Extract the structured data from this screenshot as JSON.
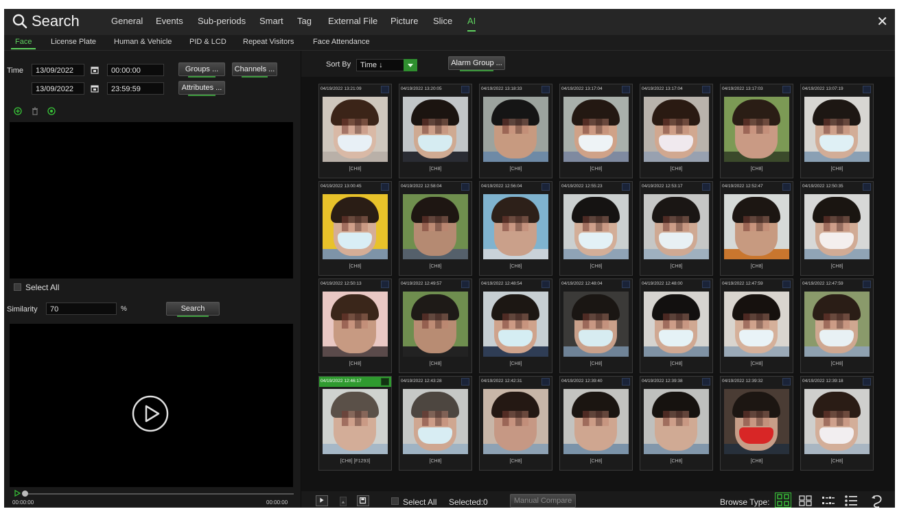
{
  "app": {
    "title": "Search"
  },
  "nav": {
    "tabs": [
      "General",
      "Events",
      "Sub-periods",
      "Smart",
      "Tag",
      "External File",
      "Picture",
      "Slice",
      "AI"
    ],
    "active": "AI"
  },
  "subnav": {
    "tabs": [
      "Face",
      "License Plate",
      "Human & Vehicle",
      "PID & LCD",
      "Repeat Visitors",
      "Face Attendance"
    ],
    "active": "Face"
  },
  "left": {
    "time_label": "Time",
    "start_date": "13/09/2022",
    "start_time": "00:00:00",
    "end_date": "13/09/2022",
    "end_time": "23:59:59",
    "groups_btn": "Groups ...",
    "channels_btn": "Channels ...",
    "attributes_btn": "Attributes ...",
    "select_all": "Select All",
    "similarity_label": "Similarity",
    "similarity_value": "70",
    "percent": "%",
    "search_btn": "Search",
    "time_start": "00:00:00",
    "time_end": "00:00:00"
  },
  "right": {
    "sort_label": "Sort By",
    "sort_value": "Time ↓",
    "alarm_group_btn": "Alarm Group ...",
    "select_all": "Select All",
    "selected": "Selected:0",
    "manual_compare": "Manual Compare",
    "browse_type": "Browse Type:"
  },
  "cards": [
    {
      "ts": "04/19/2022 13:21:09",
      "ch": "[CH8]"
    },
    {
      "ts": "04/19/2022 13:20:05",
      "ch": "[CH8]"
    },
    {
      "ts": "04/19/2022 13:18:33",
      "ch": "[CH8]"
    },
    {
      "ts": "04/19/2022 13:17:04",
      "ch": "[CH8]"
    },
    {
      "ts": "04/19/2022 13:17:04",
      "ch": "[CH8]"
    },
    {
      "ts": "04/19/2022 13:17:03",
      "ch": "[CH8]"
    },
    {
      "ts": "04/19/2022 13:07:19",
      "ch": "[CH8]"
    },
    {
      "ts": "04/19/2022 13:00:45",
      "ch": "[CH8]"
    },
    {
      "ts": "04/19/2022 12:58:04",
      "ch": "[CH8]"
    },
    {
      "ts": "04/19/2022 12:56:04",
      "ch": "[CH8]"
    },
    {
      "ts": "04/19/2022 12:55:23",
      "ch": "[CH8]"
    },
    {
      "ts": "04/19/2022 12:53:17",
      "ch": "[CH8]"
    },
    {
      "ts": "04/19/2022 12:52:47",
      "ch": "[CH8]"
    },
    {
      "ts": "04/19/2022 12:50:35",
      "ch": "[CH8]"
    },
    {
      "ts": "04/19/2022 12:50:13",
      "ch": "[CH8]"
    },
    {
      "ts": "04/19/2022 12:49:57",
      "ch": "[CH8]"
    },
    {
      "ts": "04/19/2022 12:48:54",
      "ch": "[CH8]"
    },
    {
      "ts": "04/19/2022 12:48:04",
      "ch": "[CH8]"
    },
    {
      "ts": "04/19/2022 12:48:00",
      "ch": "[CH8]"
    },
    {
      "ts": "04/19/2022 12:47:59",
      "ch": "[CH8]"
    },
    {
      "ts": "04/19/2022 12:47:59",
      "ch": "[CH8]"
    },
    {
      "ts": "04/19/2022 12:46:17",
      "ch": "[CH8] [F1293]",
      "selected": true
    },
    {
      "ts": "04/19/2022 12:43:28",
      "ch": "[CH8]"
    },
    {
      "ts": "04/19/2022 12:42:31",
      "ch": "[CH8]"
    },
    {
      "ts": "04/19/2022 12:39:40",
      "ch": "[CH8]"
    },
    {
      "ts": "04/19/2022 12:39:38",
      "ch": "[CH8]"
    },
    {
      "ts": "04/19/2022 12:39:32",
      "ch": "[CH8]"
    },
    {
      "ts": "04/19/2022 12:39:18",
      "ch": "[CH8]"
    }
  ],
  "colors": {
    "accent": "#5fd35f",
    "selected_card": "#2f9a2f",
    "panel": "#1a1a1a",
    "black": "#000000"
  }
}
